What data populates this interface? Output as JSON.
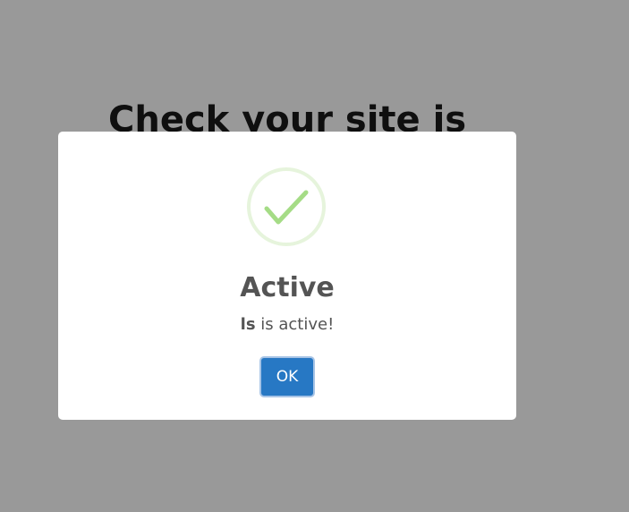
{
  "page": {
    "heading": "Check your site is"
  },
  "modal": {
    "icon": "success-check-icon",
    "title": "Active",
    "message_bold": "ls",
    "message_rest": " is active!",
    "ok_label": "OK"
  },
  "colors": {
    "overlay": "#999999",
    "modal_bg": "#ffffff",
    "title_text": "#545454",
    "icon_ring": "#e6f4dc",
    "icon_check": "#a5dc86",
    "ok_button_bg": "#2778c4",
    "ok_button_focus_ring": "#a7c4e6"
  }
}
